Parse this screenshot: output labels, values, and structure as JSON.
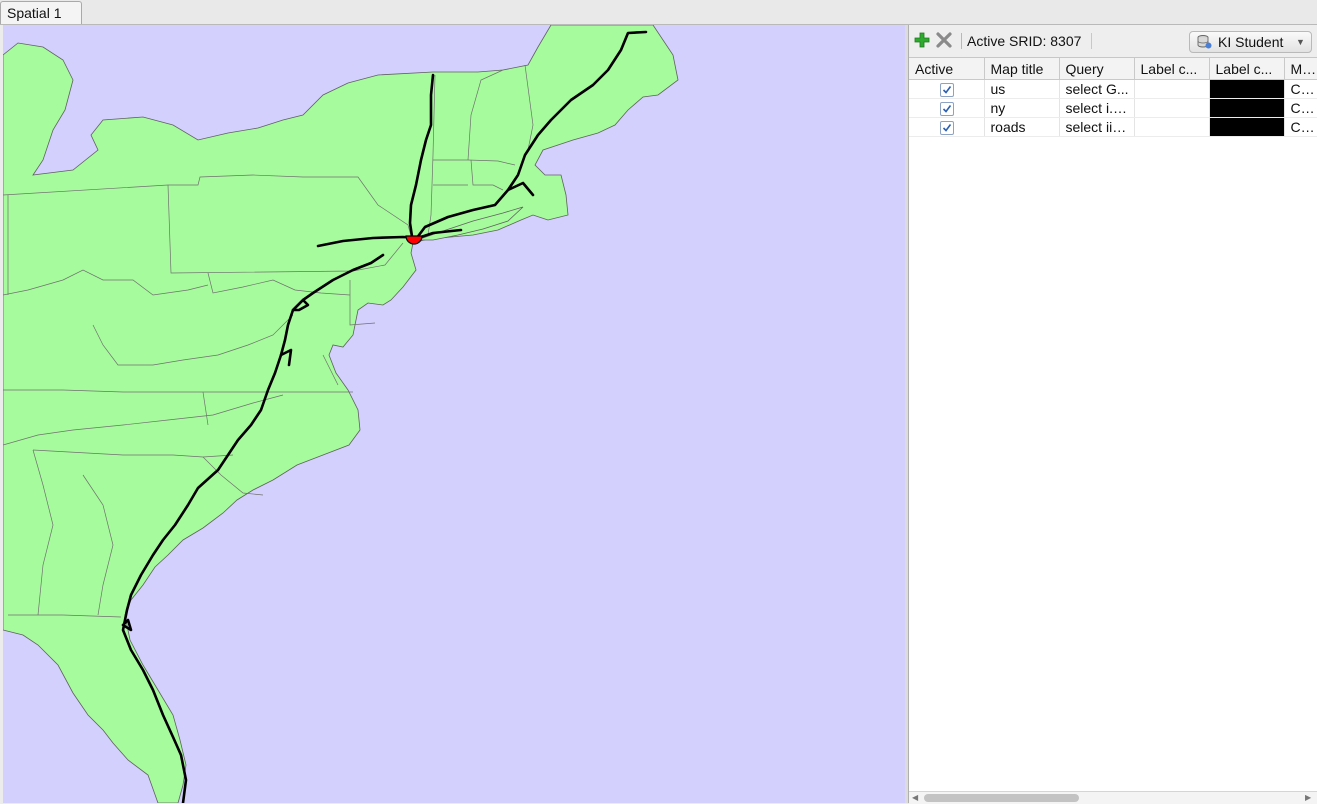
{
  "tab": {
    "label": "Spatial 1"
  },
  "colors": {
    "water": "#d3d0fd",
    "land": "#a6fb9c",
    "border": "#707070",
    "road": "#000000",
    "marker": "#ff0000"
  },
  "toolbar": {
    "add_icon": "add-icon",
    "remove_icon": "remove-icon",
    "srid_label": "Active SRID: 8307",
    "connection": "KI Student",
    "connection_icon": "database-icon"
  },
  "table": {
    "columns": [
      "Active",
      "Map title",
      "Query",
      "Label c...",
      "Label c...",
      "M"
    ],
    "rows": [
      {
        "active": true,
        "title": "us",
        "query": "select G...",
        "label_col": "",
        "label_color": "#000000",
        "marker": "Circl"
      },
      {
        "active": true,
        "title": "ny",
        "query": "select i.L...",
        "label_col": "",
        "label_color": "#000000",
        "marker": "Circl"
      },
      {
        "active": true,
        "title": "roads",
        "query": "select ii.i...",
        "label_col": "",
        "label_color": "#000000",
        "marker": "Circl"
      }
    ]
  }
}
